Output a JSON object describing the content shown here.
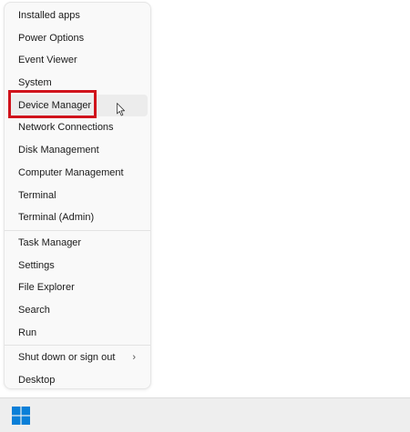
{
  "menu": {
    "group1": [
      {
        "label": "Installed apps"
      },
      {
        "label": "Power Options"
      },
      {
        "label": "Event Viewer"
      },
      {
        "label": "System"
      },
      {
        "label": "Device Manager"
      },
      {
        "label": "Network Connections"
      },
      {
        "label": "Disk Management"
      },
      {
        "label": "Computer Management"
      },
      {
        "label": "Terminal"
      },
      {
        "label": "Terminal (Admin)"
      }
    ],
    "group2": [
      {
        "label": "Task Manager"
      },
      {
        "label": "Settings"
      },
      {
        "label": "File Explorer"
      },
      {
        "label": "Search"
      },
      {
        "label": "Run"
      }
    ],
    "group3": [
      {
        "label": "Shut down or sign out",
        "chevron": "›"
      },
      {
        "label": "Desktop"
      }
    ]
  },
  "highlighted_item": "Device Manager",
  "colors": {
    "highlight_border": "#d0121b",
    "windows_logo": "#0a7fd8"
  },
  "icons": {
    "cursor": "mouse-pointer-icon",
    "start": "windows-logo-icon"
  }
}
